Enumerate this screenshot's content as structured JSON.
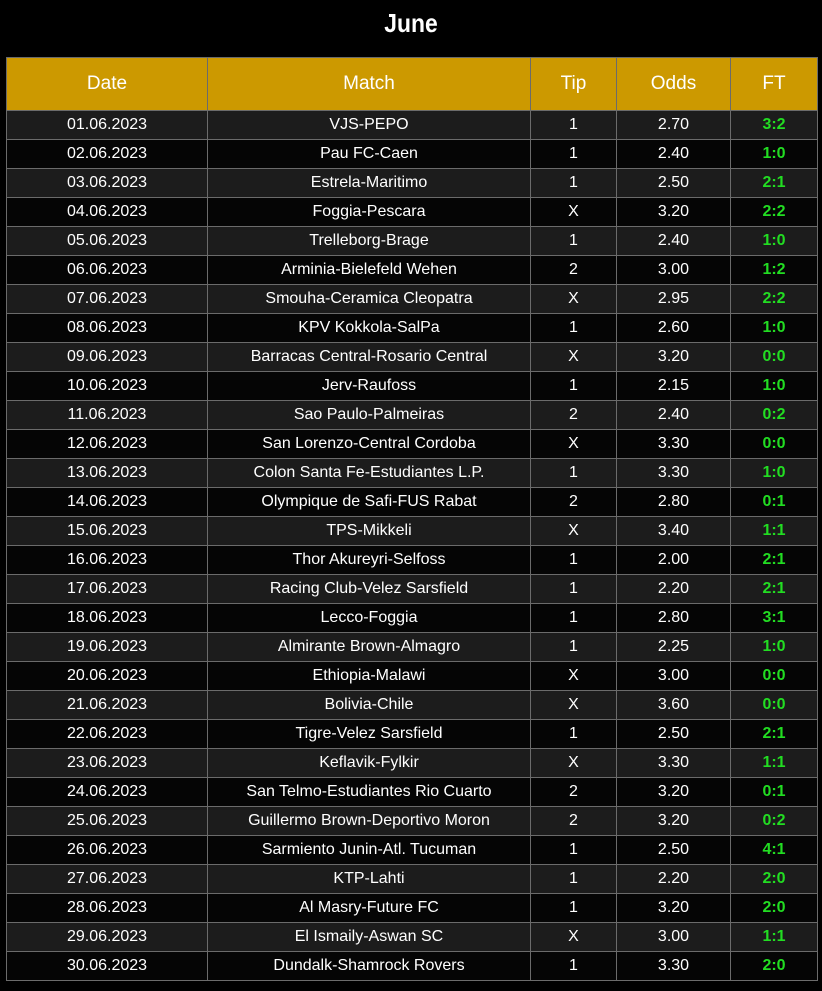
{
  "title": "June",
  "columns": {
    "date": "Date",
    "match": "Match",
    "tip": "Tip",
    "odds": "Odds",
    "ft": "FT"
  },
  "colors": {
    "header_bg": "#cc9900",
    "ft_text": "#22dd22",
    "row_odd": "#1c1c1c",
    "row_even": "#050505"
  },
  "rows": [
    {
      "date": "01.06.2023",
      "match": "VJS-PEPO",
      "tip": "1",
      "odds": "2.70",
      "ft": "3:2"
    },
    {
      "date": "02.06.2023",
      "match": "Pau FC-Caen",
      "tip": "1",
      "odds": "2.40",
      "ft": "1:0"
    },
    {
      "date": "03.06.2023",
      "match": "Estrela-Maritimo",
      "tip": "1",
      "odds": "2.50",
      "ft": "2:1"
    },
    {
      "date": "04.06.2023",
      "match": "Foggia-Pescara",
      "tip": "X",
      "odds": "3.20",
      "ft": "2:2"
    },
    {
      "date": "05.06.2023",
      "match": "Trelleborg-Brage",
      "tip": "1",
      "odds": "2.40",
      "ft": "1:0"
    },
    {
      "date": "06.06.2023",
      "match": "Arminia-Bielefeld Wehen",
      "tip": "2",
      "odds": "3.00",
      "ft": "1:2"
    },
    {
      "date": "07.06.2023",
      "match": "Smouha-Ceramica Cleopatra",
      "tip": "X",
      "odds": "2.95",
      "ft": "2:2"
    },
    {
      "date": "08.06.2023",
      "match": "KPV Kokkola-SalPa",
      "tip": "1",
      "odds": "2.60",
      "ft": "1:0"
    },
    {
      "date": "09.06.2023",
      "match": "Barracas Central-Rosario Central",
      "tip": "X",
      "odds": "3.20",
      "ft": "0:0"
    },
    {
      "date": "10.06.2023",
      "match": "Jerv-Raufoss",
      "tip": "1",
      "odds": "2.15",
      "ft": "1:0"
    },
    {
      "date": "11.06.2023",
      "match": "Sao Paulo-Palmeiras",
      "tip": "2",
      "odds": "2.40",
      "ft": "0:2"
    },
    {
      "date": "12.06.2023",
      "match": "San Lorenzo-Central Cordoba",
      "tip": "X",
      "odds": "3.30",
      "ft": "0:0"
    },
    {
      "date": "13.06.2023",
      "match": "Colon Santa Fe-Estudiantes L.P.",
      "tip": "1",
      "odds": "3.30",
      "ft": "1:0"
    },
    {
      "date": "14.06.2023",
      "match": "Olympique de Safi-FUS Rabat",
      "tip": "2",
      "odds": "2.80",
      "ft": "0:1"
    },
    {
      "date": "15.06.2023",
      "match": "TPS-Mikkeli",
      "tip": "X",
      "odds": "3.40",
      "ft": "1:1"
    },
    {
      "date": "16.06.2023",
      "match": "Thor Akureyri-Selfoss",
      "tip": "1",
      "odds": "2.00",
      "ft": "2:1"
    },
    {
      "date": "17.06.2023",
      "match": "Racing Club-Velez Sarsfield",
      "tip": "1",
      "odds": "2.20",
      "ft": "2:1"
    },
    {
      "date": "18.06.2023",
      "match": "Lecco-Foggia",
      "tip": "1",
      "odds": "2.80",
      "ft": "3:1"
    },
    {
      "date": "19.06.2023",
      "match": "Almirante Brown-Almagro",
      "tip": "1",
      "odds": "2.25",
      "ft": "1:0"
    },
    {
      "date": "20.06.2023",
      "match": "Ethiopia-Malawi",
      "tip": "X",
      "odds": "3.00",
      "ft": "0:0"
    },
    {
      "date": "21.06.2023",
      "match": "Bolivia-Chile",
      "tip": "X",
      "odds": "3.60",
      "ft": "0:0"
    },
    {
      "date": "22.06.2023",
      "match": "Tigre-Velez Sarsfield",
      "tip": "1",
      "odds": "2.50",
      "ft": "2:1"
    },
    {
      "date": "23.06.2023",
      "match": "Keflavik-Fylkir",
      "tip": "X",
      "odds": "3.30",
      "ft": "1:1"
    },
    {
      "date": "24.06.2023",
      "match": "San Telmo-Estudiantes Rio Cuarto",
      "tip": "2",
      "odds": "3.20",
      "ft": "0:1"
    },
    {
      "date": "25.06.2023",
      "match": "Guillermo Brown-Deportivo Moron",
      "tip": "2",
      "odds": "3.20",
      "ft": "0:2"
    },
    {
      "date": "26.06.2023",
      "match": "Sarmiento Junin-Atl. Tucuman",
      "tip": "1",
      "odds": "2.50",
      "ft": "4:1"
    },
    {
      "date": "27.06.2023",
      "match": "KTP-Lahti",
      "tip": "1",
      "odds": "2.20",
      "ft": "2:0"
    },
    {
      "date": "28.06.2023",
      "match": "Al Masry-Future FC",
      "tip": "1",
      "odds": "3.20",
      "ft": "2:0"
    },
    {
      "date": "29.06.2023",
      "match": "El Ismaily-Aswan SC",
      "tip": "X",
      "odds": "3.00",
      "ft": "1:1"
    },
    {
      "date": "30.06.2023",
      "match": "Dundalk-Shamrock Rovers",
      "tip": "1",
      "odds": "3.30",
      "ft": "2:0"
    }
  ]
}
